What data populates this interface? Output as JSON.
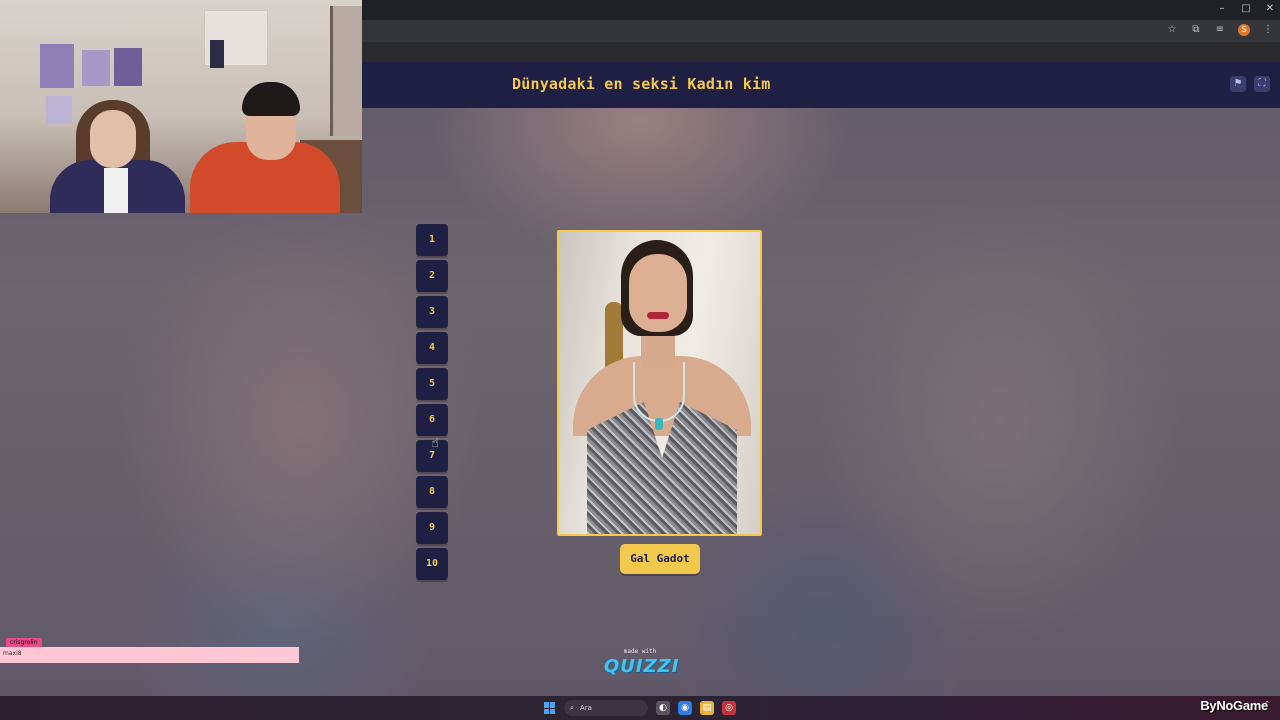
{
  "browser": {
    "window_controls": [
      "–",
      "□",
      "✕"
    ],
    "profile_initial": "S"
  },
  "quiz": {
    "title": "Dünyadaki en seksi Kadın kim",
    "numbers": [
      "1",
      "2",
      "3",
      "4",
      "5",
      "6",
      "7",
      "8",
      "9",
      "10"
    ],
    "answer_label": "Gal Gadot",
    "made_with": "made with",
    "brand": "QUIZZI"
  },
  "chat": {
    "username": "crisgrolin",
    "message": "maxi8"
  },
  "taskbar": {
    "search_placeholder": "Ara"
  },
  "watermark": "ByNoGame",
  "colors": {
    "header_bg": "#1f1f44",
    "accent_yellow": "#f2c94c",
    "brand_blue": "#3ec6f0"
  }
}
